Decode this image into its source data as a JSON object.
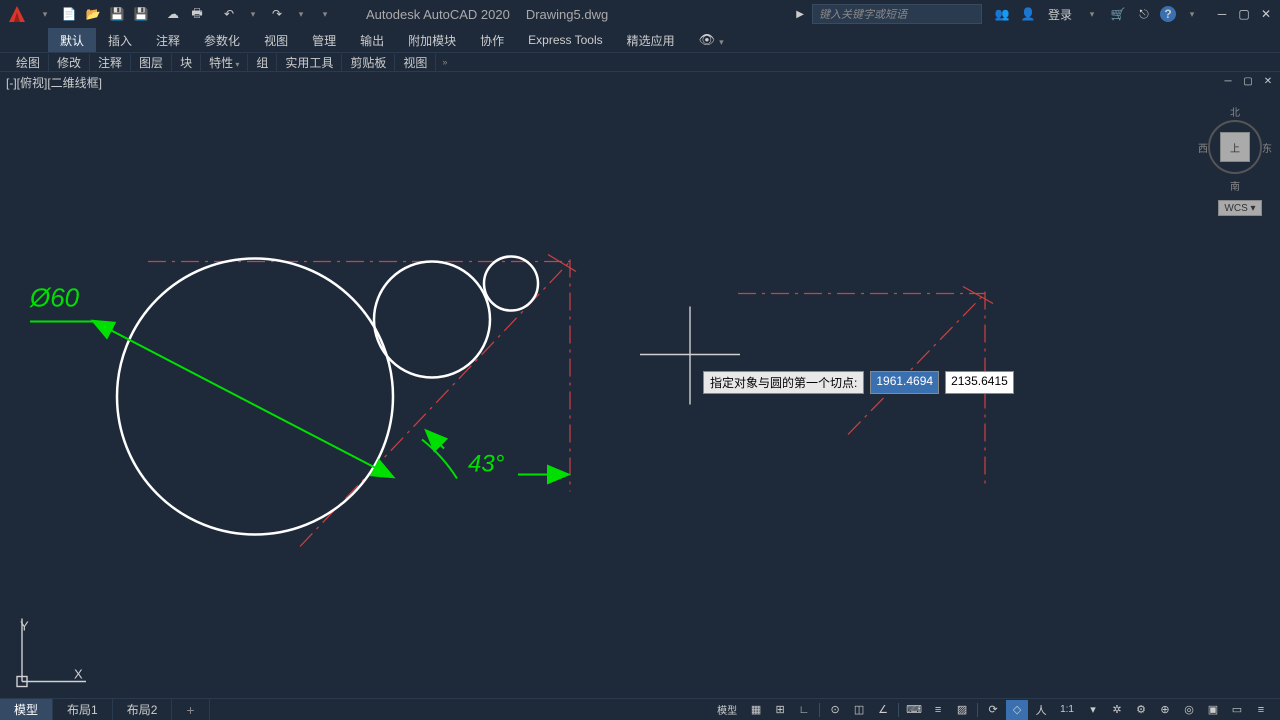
{
  "title": {
    "app": "Autodesk AutoCAD 2020",
    "doc": "Drawing5.dwg"
  },
  "search": {
    "placeholder": "键入关键字或短语"
  },
  "login": {
    "label": "登录"
  },
  "ribbon": {
    "tabs": [
      "默认",
      "插入",
      "注释",
      "参数化",
      "视图",
      "管理",
      "输出",
      "附加模块",
      "协作",
      "Express Tools",
      "精选应用"
    ],
    "active": 0
  },
  "panels": [
    "绘图",
    "修改",
    "注释",
    "图层",
    "块",
    "特性",
    "组",
    "实用工具",
    "剪贴板",
    "视图"
  ],
  "viewlabel": "[-][俯视][二维线框]",
  "viewcube": {
    "top": "上",
    "n": "北",
    "s": "南",
    "e": "东",
    "w": "西",
    "wcs": "WCS ▾"
  },
  "dynamic_input": {
    "prompt": "指定对象与圆的第一个切点:",
    "x": "1961.4694",
    "y": "2135.6415"
  },
  "bottom": {
    "tabs": [
      "模型",
      "布局1",
      "布局2"
    ],
    "active": 0,
    "model_label": "模型",
    "scale": "1:1"
  },
  "drawing": {
    "dim_diameter": "Ø60",
    "dim_angle": "43°"
  },
  "ucs": {
    "x": "X",
    "y": "Y"
  }
}
